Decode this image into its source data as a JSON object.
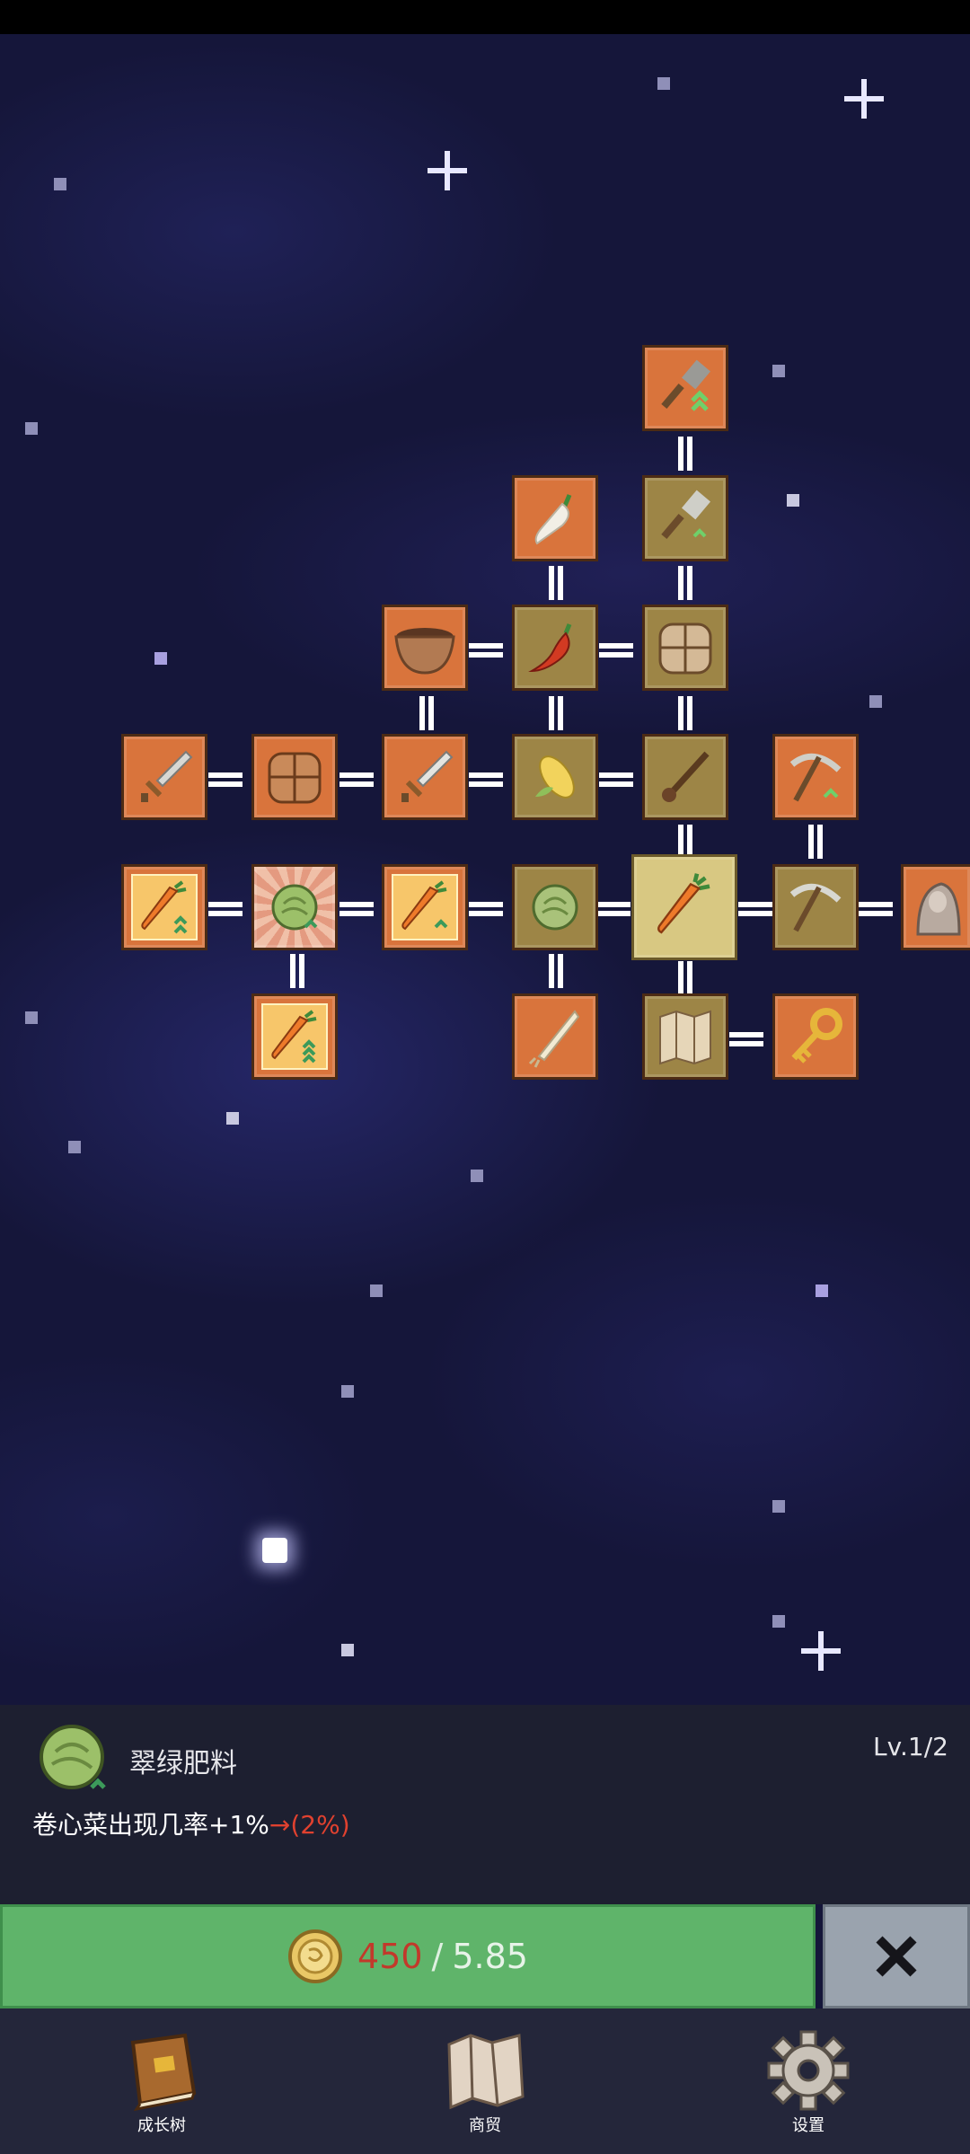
{
  "skill_panel": {
    "name": "翠绿肥料",
    "level": "Lv.1/2",
    "description": "卷心菜出现几率+1%",
    "next_value": "→(2%)"
  },
  "upgrade": {
    "coins_have": "450",
    "separator": "/",
    "coins_cost": "5.85"
  },
  "nav": {
    "items": [
      {
        "label": "成长树",
        "icon": "book-icon"
      },
      {
        "label": "商贸",
        "icon": "map-icon"
      },
      {
        "label": "设置",
        "icon": "gear-icon"
      }
    ]
  },
  "tree": {
    "nodes": [
      {
        "name": "node-shovel-upgrade",
        "state": "owned"
      },
      {
        "name": "node-radish",
        "state": "owned"
      },
      {
        "name": "node-shovel",
        "state": "locked"
      },
      {
        "name": "node-bowl",
        "state": "owned"
      },
      {
        "name": "node-chili",
        "state": "locked"
      },
      {
        "name": "node-backpack-locked",
        "state": "locked"
      },
      {
        "name": "node-sword-1",
        "state": "owned"
      },
      {
        "name": "node-backpack",
        "state": "owned"
      },
      {
        "name": "node-sword-2",
        "state": "owned"
      },
      {
        "name": "node-corn",
        "state": "locked"
      },
      {
        "name": "node-pipe",
        "state": "locked"
      },
      {
        "name": "node-pickaxe-upgrade",
        "state": "owned"
      },
      {
        "name": "node-carrot-boost-1",
        "state": "owned"
      },
      {
        "name": "node-cabbage-fertilizer",
        "state": "owned"
      },
      {
        "name": "node-carrot-boost-2",
        "state": "owned"
      },
      {
        "name": "node-cabbage",
        "state": "locked"
      },
      {
        "name": "node-carrot-selected",
        "state": "selected"
      },
      {
        "name": "node-pickaxe",
        "state": "locked"
      },
      {
        "name": "node-statue",
        "state": "owned"
      },
      {
        "name": "node-carrot-boost-3",
        "state": "owned"
      },
      {
        "name": "node-leek",
        "state": "owned"
      },
      {
        "name": "node-map",
        "state": "locked"
      },
      {
        "name": "node-key",
        "state": "owned"
      }
    ]
  },
  "colors": {
    "owned": "#d9743c",
    "locked": "#9d8546",
    "selected": "#d8c882",
    "upgrade_button": "#5fb46a",
    "close_button": "#9aa3ae",
    "coin_have": "#c2392b",
    "next_value": "#e0412f"
  }
}
